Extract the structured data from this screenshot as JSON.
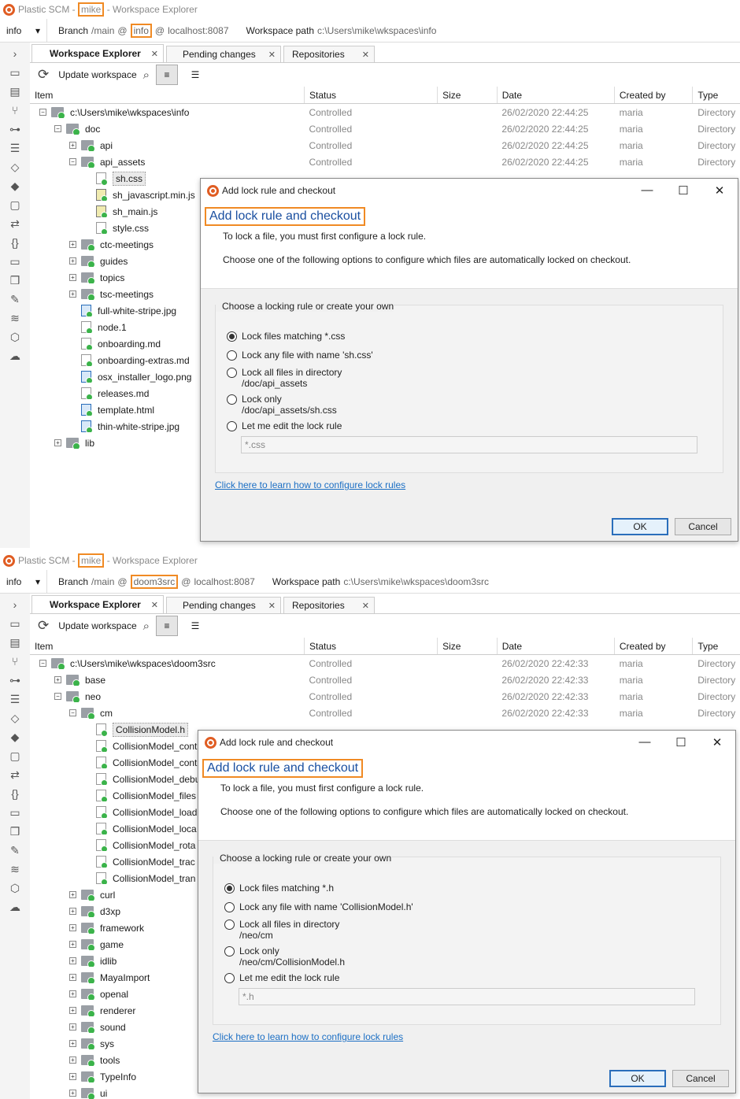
{
  "panels": [
    {
      "title": {
        "app": "Plastic SCM",
        "sep1": " - ",
        "user": "mike",
        "sep2": " - ",
        "view": "Workspace Explorer"
      },
      "toolbar": {
        "workspace": "info",
        "branch_label": "Branch",
        "branch": "/main",
        "at": "@",
        "repo": "info",
        "at2": "@",
        "server": "localhost:8087",
        "wspath_label": "Workspace path",
        "wspath": "c:\\Users\\mike\\wkspaces\\info"
      },
      "tabs": [
        {
          "label": "Workspace Explorer"
        },
        {
          "label": "Pending changes"
        },
        {
          "label": "Repositories"
        }
      ],
      "update_label": "Update workspace",
      "columns": [
        "Item",
        "Status",
        "Size",
        "Date",
        "Created by",
        "Type"
      ],
      "rows": [
        {
          "name": "c:\\Users\\mike\\wkspaces\\info",
          "status": "Controlled",
          "size": "",
          "date": "26/02/2020 22:44:25",
          "by": "maria",
          "type": "Directory"
        },
        {
          "name": "doc",
          "status": "Controlled",
          "size": "",
          "date": "26/02/2020 22:44:25",
          "by": "maria",
          "type": "Directory"
        },
        {
          "name": "api",
          "status": "Controlled",
          "size": "",
          "date": "26/02/2020 22:44:25",
          "by": "maria",
          "type": "Directory"
        },
        {
          "name": "api_assets",
          "status": "Controlled",
          "size": "",
          "date": "26/02/2020 22:44:25",
          "by": "maria",
          "type": "Directory"
        },
        {
          "name": "sh.css"
        },
        {
          "name": "sh_javascript.min.js"
        },
        {
          "name": "sh_main.js"
        },
        {
          "name": "style.css"
        },
        {
          "name": "ctc-meetings"
        },
        {
          "name": "guides"
        },
        {
          "name": "topics"
        },
        {
          "name": "tsc-meetings"
        },
        {
          "name": "full-white-stripe.jpg"
        },
        {
          "name": "node.1"
        },
        {
          "name": "onboarding.md"
        },
        {
          "name": "onboarding-extras.md"
        },
        {
          "name": "osx_installer_logo.png"
        },
        {
          "name": "releases.md"
        },
        {
          "name": "template.html"
        },
        {
          "name": "thin-white-stripe.jpg"
        },
        {
          "name": "lib"
        }
      ],
      "dialog": {
        "title": "Add lock rule and checkout",
        "heading": "Add lock rule and checkout",
        "p1": "To lock a file, you must first configure a lock rule.",
        "p2": "Choose one of the following options to configure which files are automatically locked on checkout.",
        "group_title": "Choose a locking rule or create your own",
        "options": [
          {
            "l1": "Lock files matching *.css",
            "l2": ""
          },
          {
            "l1": "Lock any file with name 'sh.css'",
            "l2": ""
          },
          {
            "l1": "Lock all files in directory",
            "l2": "/doc/api_assets"
          },
          {
            "l1": "Lock only",
            "l2": "/doc/api_assets/sh.css"
          },
          {
            "l1": "Let me edit the lock rule",
            "l2": ""
          }
        ],
        "rule_placeholder": "*.css",
        "link": "Click here to learn how to configure lock rules",
        "ok": "OK",
        "cancel": "Cancel"
      }
    },
    {
      "title": {
        "app": "Plastic SCM",
        "sep1": " - ",
        "user": "mike",
        "sep2": " - ",
        "view": "Workspace Explorer"
      },
      "toolbar": {
        "workspace": "info",
        "branch_label": "Branch",
        "branch": "/main",
        "at": "@",
        "repo": "doom3src",
        "at2": "@",
        "server": "localhost:8087",
        "wspath_label": "Workspace path",
        "wspath": "c:\\Users\\mike\\wkspaces\\doom3src"
      },
      "tabs": [
        {
          "label": "Workspace Explorer"
        },
        {
          "label": "Pending changes"
        },
        {
          "label": "Repositories"
        }
      ],
      "update_label": "Update workspace",
      "columns": [
        "Item",
        "Status",
        "Size",
        "Date",
        "Created by",
        "Type"
      ],
      "rows": [
        {
          "name": "c:\\Users\\mike\\wkspaces\\doom3src",
          "status": "Controlled",
          "size": "",
          "date": "26/02/2020 22:42:33",
          "by": "maria",
          "type": "Directory"
        },
        {
          "name": "base",
          "status": "Controlled",
          "size": "",
          "date": "26/02/2020 22:42:33",
          "by": "maria",
          "type": "Directory"
        },
        {
          "name": "neo",
          "status": "Controlled",
          "size": "",
          "date": "26/02/2020 22:42:33",
          "by": "maria",
          "type": "Directory"
        },
        {
          "name": "cm",
          "status": "Controlled",
          "size": "",
          "date": "26/02/2020 22:42:33",
          "by": "maria",
          "type": "Directory"
        },
        {
          "name": "CollisionModel.h"
        },
        {
          "name": "CollisionModel_cont"
        },
        {
          "name": "CollisionModel_cont"
        },
        {
          "name": "CollisionModel_debu"
        },
        {
          "name": "CollisionModel_files"
        },
        {
          "name": "CollisionModel_load"
        },
        {
          "name": "CollisionModel_loca"
        },
        {
          "name": "CollisionModel_rota"
        },
        {
          "name": "CollisionModel_trac"
        },
        {
          "name": "CollisionModel_tran"
        },
        {
          "name": "curl"
        },
        {
          "name": "d3xp"
        },
        {
          "name": "framework"
        },
        {
          "name": "game"
        },
        {
          "name": "idlib"
        },
        {
          "name": "MayaImport"
        },
        {
          "name": "openal"
        },
        {
          "name": "renderer"
        },
        {
          "name": "sound"
        },
        {
          "name": "sys"
        },
        {
          "name": "tools"
        },
        {
          "name": "TypeInfo"
        },
        {
          "name": "ui"
        }
      ],
      "dialog": {
        "title": "Add lock rule and checkout",
        "heading": "Add lock rule and checkout",
        "p1": "To lock a file, you must first configure a lock rule.",
        "p2": "Choose one of the following options to configure which files are automatically locked on checkout.",
        "group_title": "Choose a locking rule or create your own",
        "options": [
          {
            "l1": "Lock files matching *.h",
            "l2": ""
          },
          {
            "l1": "Lock any file with name 'CollisionModel.h'",
            "l2": ""
          },
          {
            "l1": "Lock all files in directory",
            "l2": "/neo/cm"
          },
          {
            "l1": "Lock only",
            "l2": "/neo/cm/CollisionModel.h"
          },
          {
            "l1": "Let me edit the lock rule",
            "l2": ""
          }
        ],
        "rule_placeholder": "*.h",
        "link": "Click here to learn how to configure lock rules",
        "ok": "OK",
        "cancel": "Cancel"
      }
    }
  ],
  "colors": {
    "accent": "#f08a24",
    "link": "#1c6fc4",
    "heading": "#1a4fa0",
    "status_ok": "#3bb34a"
  }
}
